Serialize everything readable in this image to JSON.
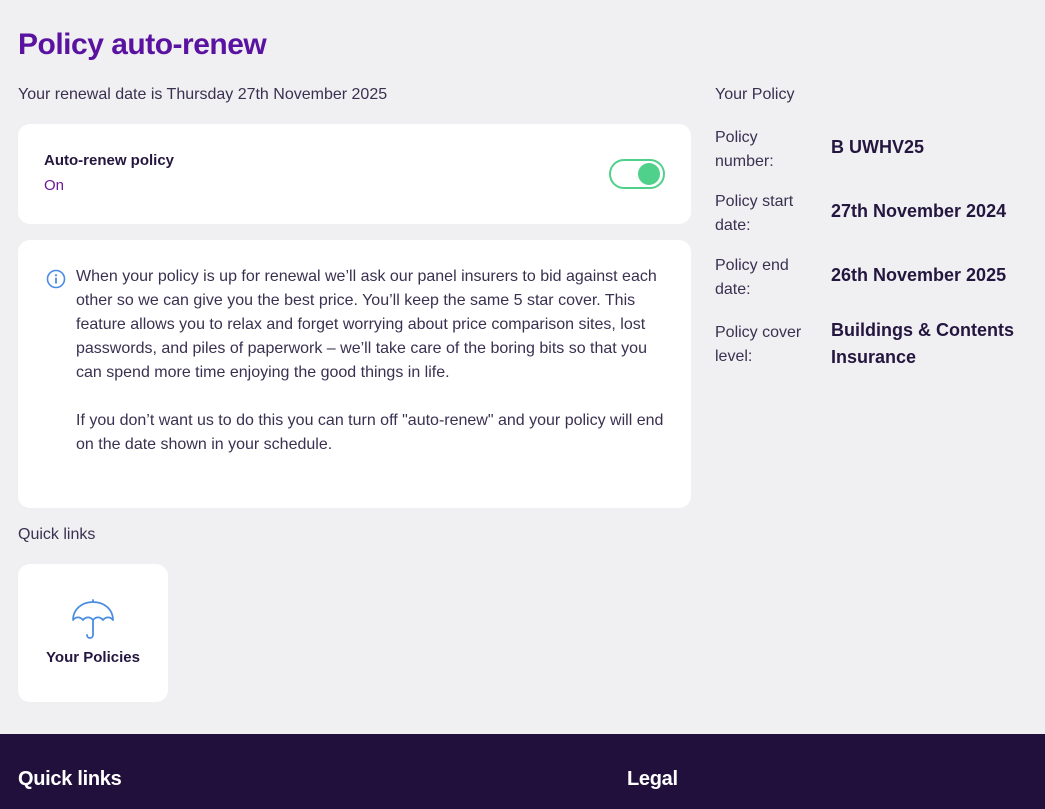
{
  "page": {
    "title": "Policy auto-renew",
    "renewal_text": "Your renewal date is Thursday 27th November 2025"
  },
  "auto_renew": {
    "title": "Auto-renew policy",
    "status": "On",
    "enabled": true,
    "toggle_color": "#4fd18b"
  },
  "info": {
    "icon": "info-icon",
    "paragraph1": "When your policy is up for renewal we’ll ask our panel insurers to bid against each other so we can give you the best price. You’ll keep the same 5 star cover. This feature allows you to relax and forget worrying about price comparison sites, lost passwords, and piles of paperwork – we’ll take care of the boring bits so that you can spend more time enjoying the good things in life.",
    "paragraph2": "If you don’t want us to do this you can turn off \"auto-renew\" and your policy will end on the date shown in your schedule."
  },
  "quick_links": {
    "label": "Quick links",
    "tiles": [
      {
        "label": "Your Policies",
        "icon": "umbrella-icon"
      }
    ]
  },
  "your_policy": {
    "heading": "Your Policy",
    "rows": [
      {
        "label": "Policy number:",
        "value": "B UWHV25"
      },
      {
        "label": "Policy start date:",
        "value": "27th November 2024"
      },
      {
        "label": "Policy end date:",
        "value": "26th November 2025"
      },
      {
        "label": "Policy cover level:",
        "value": "Buildings & Contents Insurance"
      }
    ]
  },
  "footer": {
    "quick_links_heading": "Quick links",
    "legal_heading": "Legal"
  },
  "colors": {
    "brand_purple": "#5a12a0",
    "footer_bg": "#21103c",
    "accent_green": "#4fd18b",
    "icon_blue": "#4a8de0"
  }
}
